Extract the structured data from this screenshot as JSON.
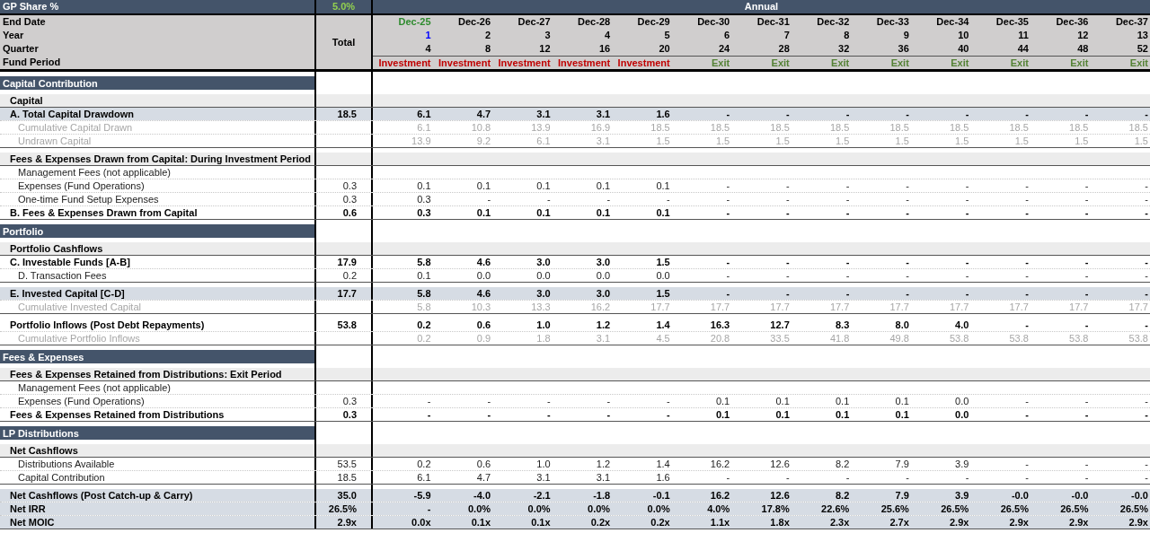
{
  "header": {
    "gp_share_label": "GP Share %",
    "gp_share_value": "5.0%",
    "period_title": "Annual",
    "total_label": "Total",
    "row_labels": [
      "End Date",
      "Year",
      "Quarter",
      "Fund Period"
    ]
  },
  "columns": [
    {
      "end_date": "Dec-25",
      "year": "1",
      "quarter": "4",
      "fund_period": "Investment",
      "kind": "investment",
      "input_date": true,
      "input_year": true
    },
    {
      "end_date": "Dec-26",
      "year": "2",
      "quarter": "8",
      "fund_period": "Investment",
      "kind": "investment",
      "input_date": false,
      "input_year": false
    },
    {
      "end_date": "Dec-27",
      "year": "3",
      "quarter": "12",
      "fund_period": "Investment",
      "kind": "investment",
      "input_date": false,
      "input_year": false
    },
    {
      "end_date": "Dec-28",
      "year": "4",
      "quarter": "16",
      "fund_period": "Investment",
      "kind": "investment",
      "input_date": false,
      "input_year": false
    },
    {
      "end_date": "Dec-29",
      "year": "5",
      "quarter": "20",
      "fund_period": "Investment",
      "kind": "investment",
      "input_date": false,
      "input_year": false
    },
    {
      "end_date": "Dec-30",
      "year": "6",
      "quarter": "24",
      "fund_period": "Exit",
      "kind": "exit",
      "input_date": false,
      "input_year": false
    },
    {
      "end_date": "Dec-31",
      "year": "7",
      "quarter": "28",
      "fund_period": "Exit",
      "kind": "exit",
      "input_date": false,
      "input_year": false
    },
    {
      "end_date": "Dec-32",
      "year": "8",
      "quarter": "32",
      "fund_period": "Exit",
      "kind": "exit",
      "input_date": false,
      "input_year": false
    },
    {
      "end_date": "Dec-33",
      "year": "9",
      "quarter": "36",
      "fund_period": "Exit",
      "kind": "exit",
      "input_date": false,
      "input_year": false
    },
    {
      "end_date": "Dec-34",
      "year": "10",
      "quarter": "40",
      "fund_period": "Exit",
      "kind": "exit",
      "input_date": false,
      "input_year": false
    },
    {
      "end_date": "Dec-35",
      "year": "11",
      "quarter": "44",
      "fund_period": "Exit",
      "kind": "exit",
      "input_date": false,
      "input_year": false
    },
    {
      "end_date": "Dec-36",
      "year": "12",
      "quarter": "48",
      "fund_period": "Exit",
      "kind": "exit",
      "input_date": false,
      "input_year": false
    },
    {
      "end_date": "Dec-37",
      "year": "13",
      "quarter": "52",
      "fund_period": "Exit",
      "kind": "exit",
      "input_date": false,
      "input_year": false
    }
  ],
  "rows": [
    {
      "kind": "section",
      "label": "Capital Contribution"
    },
    {
      "kind": "subheader",
      "label": "Capital"
    },
    {
      "kind": "total",
      "label": "A. Total Capital Drawdown",
      "total": "18.5",
      "values": [
        "6.1",
        "4.7",
        "3.1",
        "3.1",
        "1.6",
        "-",
        "-",
        "-",
        "-",
        "-",
        "-",
        "-",
        "-"
      ]
    },
    {
      "kind": "memo",
      "label": "Cumulative Capital Drawn",
      "values": [
        "6.1",
        "10.8",
        "13.9",
        "16.9",
        "18.5",
        "18.5",
        "18.5",
        "18.5",
        "18.5",
        "18.5",
        "18.5",
        "18.5",
        "18.5"
      ]
    },
    {
      "kind": "memo",
      "label": "Undrawn Capital",
      "values": [
        "13.9",
        "9.2",
        "6.1",
        "3.1",
        "1.5",
        "1.5",
        "1.5",
        "1.5",
        "1.5",
        "1.5",
        "1.5",
        "1.5",
        "1.5"
      ]
    },
    {
      "kind": "subheader",
      "label": "Fees & Expenses Drawn from Capital: During Investment Period"
    },
    {
      "kind": "item",
      "label": "Management Fees (not applicable)"
    },
    {
      "kind": "item",
      "label": "Expenses (Fund Operations)",
      "total": "0.3",
      "values": [
        "0.1",
        "0.1",
        "0.1",
        "0.1",
        "0.1",
        "-",
        "-",
        "-",
        "-",
        "-",
        "-",
        "-",
        "-"
      ]
    },
    {
      "kind": "item",
      "label": "One-time Fund Setup Expenses",
      "total": "0.3",
      "values": [
        "0.3",
        "-",
        "-",
        "-",
        "-",
        "-",
        "-",
        "-",
        "-",
        "-",
        "-",
        "-",
        "-"
      ]
    },
    {
      "kind": "bold",
      "label": "B. Fees & Expenses Drawn from Capital",
      "total": "0.6",
      "values": [
        "0.3",
        "0.1",
        "0.1",
        "0.1",
        "0.1",
        "-",
        "-",
        "-",
        "-",
        "-",
        "-",
        "-",
        "-"
      ]
    },
    {
      "kind": "section",
      "label": "Portfolio"
    },
    {
      "kind": "subheader",
      "label": "Portfolio Cashflows"
    },
    {
      "kind": "bold",
      "label": "C. Investable Funds [A-B]",
      "total": "17.9",
      "values": [
        "5.8",
        "4.6",
        "3.0",
        "3.0",
        "1.5",
        "-",
        "-",
        "-",
        "-",
        "-",
        "-",
        "-",
        "-"
      ]
    },
    {
      "kind": "item",
      "label": "D. Transaction Fees",
      "total": "0.2",
      "values": [
        "0.1",
        "0.0",
        "0.0",
        "0.0",
        "0.0",
        "-",
        "-",
        "-",
        "-",
        "-",
        "-",
        "-",
        "-"
      ]
    },
    {
      "kind": "total",
      "label": "E. Invested Capital [C-D]",
      "total": "17.7",
      "values": [
        "5.8",
        "4.6",
        "3.0",
        "3.0",
        "1.5",
        "-",
        "-",
        "-",
        "-",
        "-",
        "-",
        "-",
        "-"
      ]
    },
    {
      "kind": "memo",
      "label": "Cumulative Invested Capital",
      "values": [
        "5.8",
        "10.3",
        "13.3",
        "16.2",
        "17.7",
        "17.7",
        "17.7",
        "17.7",
        "17.7",
        "17.7",
        "17.7",
        "17.7",
        "17.7"
      ]
    },
    {
      "kind": "bold",
      "label": "Portfolio Inflows (Post Debt Repayments)",
      "total": "53.8",
      "values": [
        "0.2",
        "0.6",
        "1.0",
        "1.2",
        "1.4",
        "16.3",
        "12.7",
        "8.3",
        "8.0",
        "4.0",
        "-",
        "-",
        "-"
      ]
    },
    {
      "kind": "memo",
      "label": "Cumulative Portfolio Inflows",
      "values": [
        "0.2",
        "0.9",
        "1.8",
        "3.1",
        "4.5",
        "20.8",
        "33.5",
        "41.8",
        "49.8",
        "53.8",
        "53.8",
        "53.8",
        "53.8"
      ]
    },
    {
      "kind": "section",
      "label": "Fees & Expenses"
    },
    {
      "kind": "subheader",
      "label": "Fees & Expenses Retained from Distributions: Exit Period"
    },
    {
      "kind": "item",
      "label": "Management Fees (not applicable)"
    },
    {
      "kind": "item",
      "label": "Expenses (Fund Operations)",
      "total": "0.3",
      "values": [
        "-",
        "-",
        "-",
        "-",
        "-",
        "0.1",
        "0.1",
        "0.1",
        "0.1",
        "0.0",
        "-",
        "-",
        "-"
      ]
    },
    {
      "kind": "bold",
      "label": "Fees & Expenses Retained from Distributions",
      "total": "0.3",
      "values": [
        "-",
        "-",
        "-",
        "-",
        "-",
        "0.1",
        "0.1",
        "0.1",
        "0.1",
        "0.0",
        "-",
        "-",
        "-"
      ]
    },
    {
      "kind": "section",
      "label": "LP Distributions"
    },
    {
      "kind": "subheader",
      "label": "Net Cashflows"
    },
    {
      "kind": "item",
      "label": "Distributions Available",
      "total": "53.5",
      "values": [
        "0.2",
        "0.6",
        "1.0",
        "1.2",
        "1.4",
        "16.2",
        "12.6",
        "8.2",
        "7.9",
        "3.9",
        "-",
        "-",
        "-"
      ]
    },
    {
      "kind": "item",
      "label": "Capital Contribution",
      "total": "18.5",
      "values": [
        "6.1",
        "4.7",
        "3.1",
        "3.1",
        "1.6",
        "-",
        "-",
        "-",
        "-",
        "-",
        "-",
        "-",
        "-"
      ]
    },
    {
      "kind": "total",
      "label": "Net Cashflows (Post Catch-up & Carry)",
      "total": "35.0",
      "values": [
        "-5.9",
        "-4.0",
        "-2.1",
        "-1.8",
        "-0.1",
        "16.2",
        "12.6",
        "8.2",
        "7.9",
        "3.9",
        "-0.0",
        "-0.0",
        "-0.0"
      ]
    },
    {
      "kind": "total",
      "label": "Net IRR",
      "total": "26.5%",
      "values": [
        "-",
        "0.0%",
        "0.0%",
        "0.0%",
        "0.0%",
        "4.0%",
        "17.8%",
        "22.6%",
        "25.6%",
        "26.5%",
        "26.5%",
        "26.5%",
        "26.5%"
      ]
    },
    {
      "kind": "total",
      "label": "Net MOIC",
      "total": "2.9x",
      "values": [
        "0.0x",
        "0.1x",
        "0.1x",
        "0.2x",
        "0.2x",
        "1.1x",
        "1.8x",
        "2.3x",
        "2.7x",
        "2.9x",
        "2.9x",
        "2.9x",
        "2.9x"
      ]
    }
  ]
}
